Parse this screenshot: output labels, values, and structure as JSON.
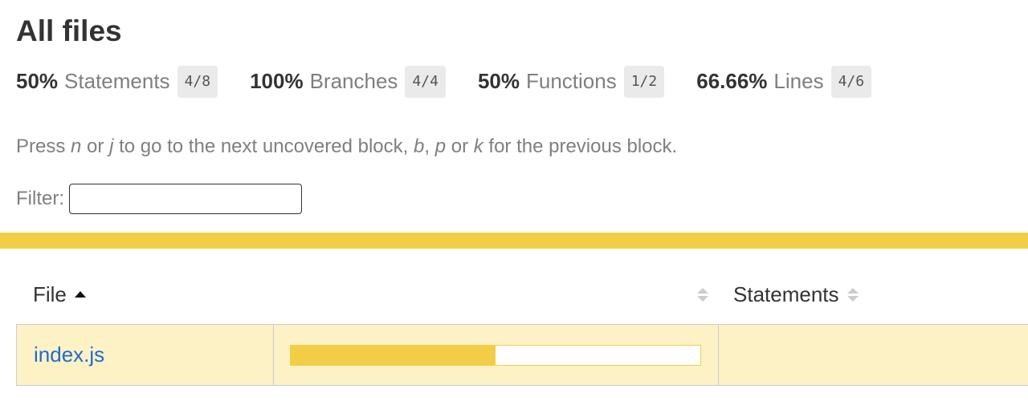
{
  "title": "All files",
  "summary": [
    {
      "pct": "50%",
      "label": "Statements",
      "fraction": "4/8"
    },
    {
      "pct": "100%",
      "label": "Branches",
      "fraction": "4/4"
    },
    {
      "pct": "50%",
      "label": "Functions",
      "fraction": "1/2"
    },
    {
      "pct": "66.66%",
      "label": "Lines",
      "fraction": "4/6"
    }
  ],
  "help": {
    "t1": "Press ",
    "k1": "n",
    "t2": " or ",
    "k2": "j",
    "t3": " to go to the next uncovered block, ",
    "k3": "b",
    "t4": ", ",
    "k4": "p",
    "t5": " or ",
    "k5": "k",
    "t6": " for the previous block."
  },
  "filter": {
    "label": "Filter:",
    "value": ""
  },
  "colors": {
    "status_medium": "#f2ce46",
    "row_medium_bg": "#fcf2c5",
    "link": "#1f6bd1"
  },
  "table": {
    "headers": {
      "file": "File",
      "statements": "Statements"
    },
    "rows": [
      {
        "file": "index.js",
        "statements_coverage": 0.5
      }
    ]
  },
  "icons": {
    "sort_ascending": "caret-up-icon",
    "sortable": "sort-both-icon"
  }
}
